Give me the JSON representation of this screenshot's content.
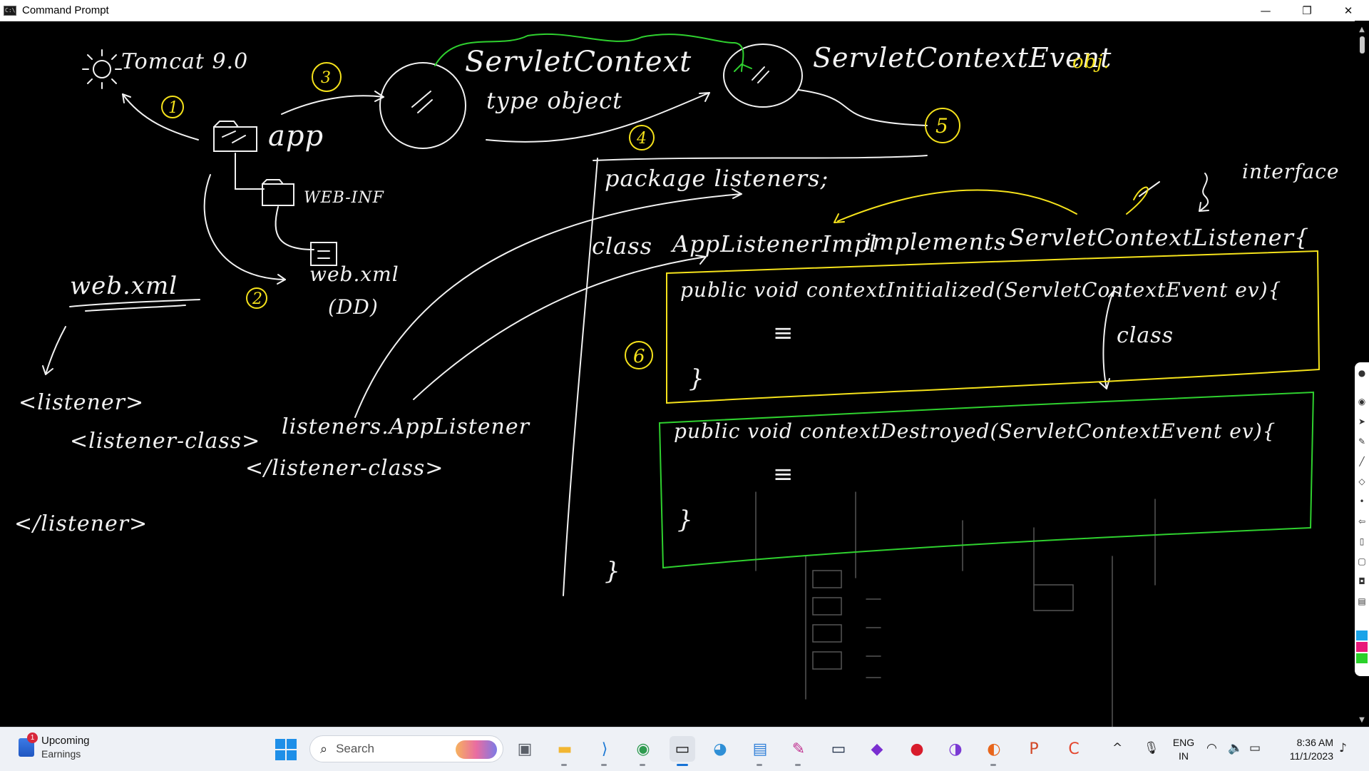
{
  "window": {
    "title": "Command Prompt",
    "app_icon_text": "C:\\",
    "controls": {
      "minimize": "—",
      "maximize": "❐",
      "close": "✕"
    }
  },
  "whiteboard": {
    "colors": {
      "ink": "#f2f2f2",
      "yellow": "#f5e21b",
      "green": "#2fd12f"
    },
    "left_diagram": {
      "server": "Tomcat 9.0",
      "app_label": "app",
      "webinf_label": "WEB-INF",
      "webxml_label": "web.xml",
      "dd_label": "(DD)",
      "step_labels": [
        "1",
        "2",
        "3",
        "4",
        "5",
        "6"
      ]
    },
    "context_object": {
      "line1": "ServletContext",
      "line2": "type object"
    },
    "event_object": {
      "label": "ServletContextEvent",
      "suffix": "obj."
    },
    "webxml_snippet": {
      "heading": "web.xml",
      "open_tag": "<listener>",
      "class_open": "<listener-class>",
      "class_value": "listeners.AppListener",
      "class_close": "</listener-class>",
      "close_tag": "</listener>"
    },
    "code": {
      "package_line": "package listeners;",
      "class_keyword": "class",
      "class_name": "AppListenerImpl",
      "implements_keyword": "implements",
      "interface_name": "ServletContextListener{",
      "interface_note": "interface",
      "class_note": "class",
      "method1": "public void contextInitialized(ServletContextEvent ev){",
      "method2": "public void contextDestroyed(ServletContextEvent ev){",
      "body_mark": "≡",
      "close_brace": "}",
      "final_brace": "}"
    }
  },
  "taskbar": {
    "widget": {
      "badge": "1",
      "title": "Upcoming",
      "subtitle": "Earnings"
    },
    "search_placeholder": "Search",
    "apps": [
      {
        "name": "task-view",
        "glyph": "▣",
        "color": "#5a5f68"
      },
      {
        "name": "file-explorer",
        "glyph": "▬",
        "color": "#f2b632"
      },
      {
        "name": "vs-code",
        "glyph": "⟩",
        "color": "#1d79d4"
      },
      {
        "name": "chrome",
        "glyph": "◉",
        "color": "#2e9b4f"
      },
      {
        "name": "command-prompt",
        "glyph": "▭",
        "color": "#111111",
        "active": true
      },
      {
        "name": "paint",
        "glyph": "◕",
        "color": "#2f8fd6"
      },
      {
        "name": "notepad",
        "glyph": "▤",
        "color": "#2f7fd8"
      },
      {
        "name": "pen-tool",
        "glyph": "✎",
        "color": "#c0308f"
      },
      {
        "name": "mysql-workbench",
        "glyph": "▭",
        "color": "#1c2b44"
      },
      {
        "name": "intellij",
        "glyph": "◆",
        "color": "#7a2fd1"
      },
      {
        "name": "opera",
        "glyph": "●",
        "color": "#d81c2c"
      },
      {
        "name": "game-bar",
        "glyph": "◑",
        "color": "#7b3ad4"
      },
      {
        "name": "firefox",
        "glyph": "◐",
        "color": "#e8661c"
      },
      {
        "name": "powerpoint",
        "glyph": "P",
        "color": "#d24726"
      },
      {
        "name": "screen-recorder",
        "glyph": "C",
        "color": "#e4452c"
      }
    ],
    "tray": {
      "chevron": "^",
      "lang_line1": "ENG",
      "lang_line2": "IN",
      "time": "8:36 AM",
      "date": "11/1/2023"
    }
  },
  "pen_toolbar": {
    "swatches": [
      "#1aa3e8",
      "#e8197a",
      "#2ad12a"
    ]
  }
}
